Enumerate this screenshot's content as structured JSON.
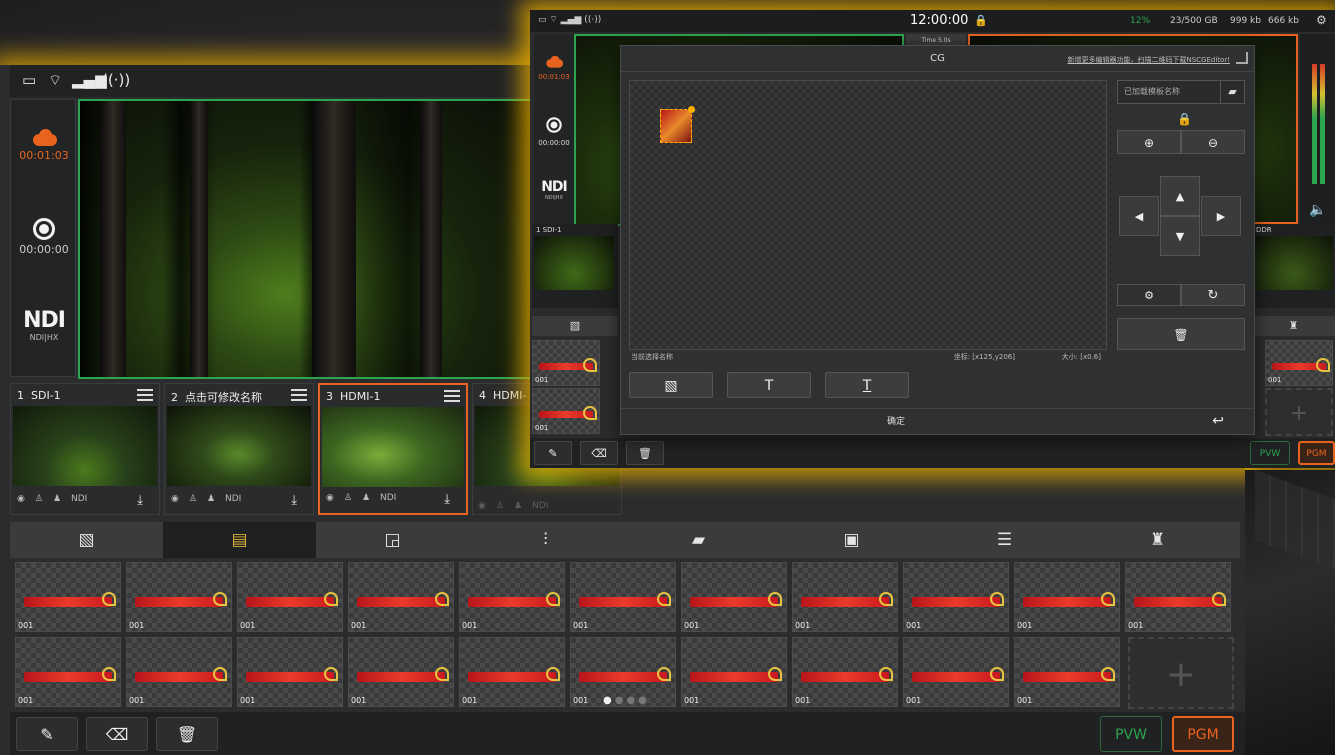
{
  "main": {
    "left_panel": {
      "stream_time": "00:01:03",
      "record_time": "00:00:00",
      "ndi_logo": "NDI",
      "ndi_sub": "NDI|HX"
    },
    "sources": [
      {
        "index": "1",
        "name": "SDI-1",
        "ndi": "NDI"
      },
      {
        "index": "2",
        "name": "点击可修改名称",
        "ndi": "NDI"
      },
      {
        "index": "3",
        "name": "HDMI-1",
        "ndi": "NDI"
      },
      {
        "index": "4",
        "name": "HDMI-",
        "ndi": "NDI"
      }
    ],
    "tabs": [
      "image-tab",
      "cg-tab",
      "pip-tab",
      "audio-tab",
      "media-tab",
      "countdown-tab",
      "notes-tab",
      "scene-tab"
    ],
    "cg_items": [
      "001",
      "001",
      "001",
      "001",
      "001",
      "001",
      "001",
      "001",
      "001",
      "001",
      "001",
      "001",
      "001",
      "001",
      "001",
      "001",
      "001",
      "001",
      "001",
      "001",
      "001"
    ],
    "page_indicator": {
      "total": 4,
      "active": 1
    },
    "bottom": {
      "pvw": "PVW",
      "pgm": "PGM"
    }
  },
  "front": {
    "status": {
      "clock": "12:00:00",
      "storage": "23/500 GB",
      "up": "999 kb",
      "down": "666 kb",
      "cpu": "12%"
    },
    "left_panel": {
      "stream_time": "00:01:03",
      "record_time": "00:00:00",
      "ndi_logo": "NDI",
      "ndi_sub": "NDI|HX"
    },
    "source_labels": [
      "1 SDI-1",
      "DDR"
    ],
    "preview_badge": "Time 5.0s",
    "cg_dialog": {
      "title": "CG",
      "hint": "新增更多编辑器功能，扫描二维码下载NSCGEditor!",
      "name_input_placeholder": "已加载模板名称",
      "selected_name_label": "当前选择名称",
      "coords": "坐标: [x125,y206]",
      "size": "大小: [x0.6]",
      "confirm": "确定",
      "buttons": {
        "image": "image",
        "text": "T",
        "text2": "T"
      }
    },
    "bottom": {
      "pvw": "PVW",
      "pgm": "PGM"
    }
  },
  "colors": {
    "accent_orange": "#e8641e",
    "pvw_green": "#2da44e",
    "glow": "#e0a800",
    "cg_tab_active": "#d9b238"
  }
}
